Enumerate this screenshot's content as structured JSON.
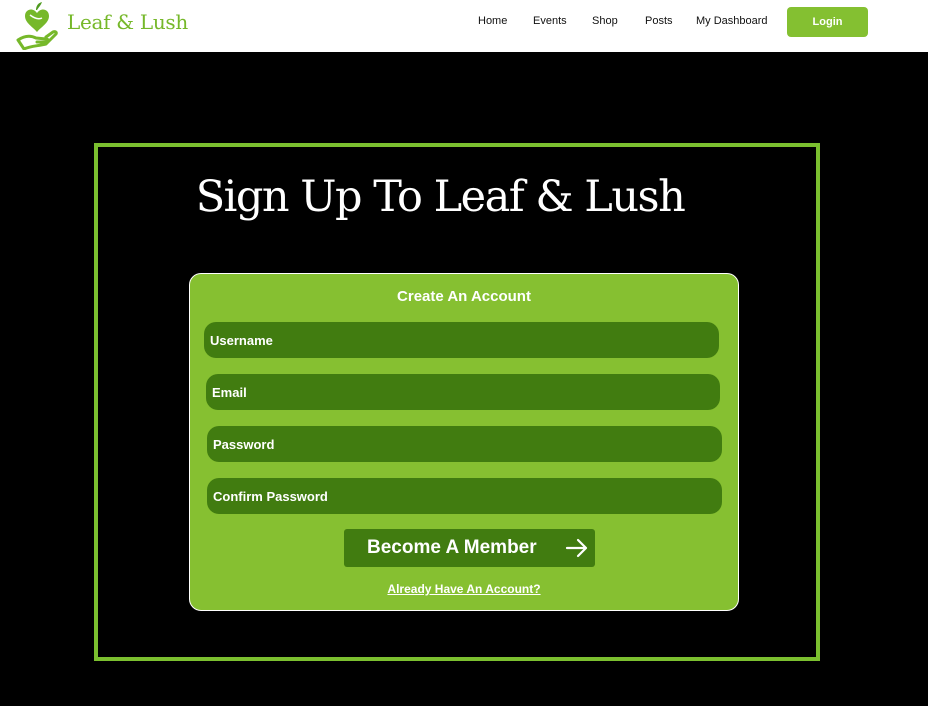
{
  "header": {
    "brand": "Leaf & Lush",
    "nav": [
      "Home",
      "Events",
      "Shop",
      "Posts",
      "My Dashboard"
    ],
    "login": "Login"
  },
  "main": {
    "title": "Sign Up To Leaf & Lush",
    "card_title": "Create An Account",
    "fields": {
      "username": "Username",
      "email": "Email",
      "password": "Password",
      "confirm": "Confirm Password"
    },
    "submit": "Become A Member",
    "already": "Already Have An Account?"
  },
  "colors": {
    "accent": "#84c031",
    "field": "#417c10",
    "background": "#000000",
    "header": "#ffffff"
  }
}
